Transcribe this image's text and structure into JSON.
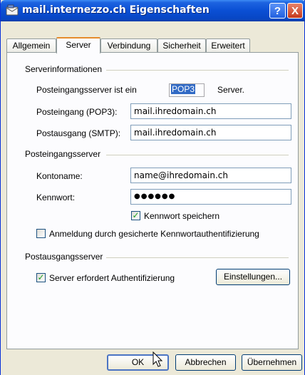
{
  "window": {
    "title": "mail.internezzo.ch Eigenschaften",
    "help_label": "?",
    "close_label": "X"
  },
  "tabs": [
    {
      "label": "Allgemein",
      "active": false
    },
    {
      "label": "Server",
      "active": true
    },
    {
      "label": "Verbindung",
      "active": false
    },
    {
      "label": "Sicherheit",
      "active": false
    },
    {
      "label": "Erweitert",
      "active": false
    }
  ],
  "serverinfo": {
    "group_label": "Serverinformationen",
    "type_label": "Posteingangsserver ist ein",
    "type_value": "POP3",
    "type_suffix": "Server.",
    "incoming_label": "Posteingang (POP3):",
    "incoming_value": "mail.ihredomain.ch",
    "outgoing_label": "Postausgang (SMTP):",
    "outgoing_value": "mail.ihredomain.ch"
  },
  "incoming": {
    "group_label": "Posteingangsserver",
    "account_label": "Kontoname:",
    "account_value": "name@ihredomain.ch",
    "password_label": "Kennwort:",
    "password_value": "●●●●●●",
    "remember_label": "Kennwort speichern",
    "remember_checked": true,
    "spa_label": "Anmeldung durch gesicherte Kennwortauthentifizierung",
    "spa_checked": false
  },
  "outgoing": {
    "group_label": "Postausgangsserver",
    "auth_label": "Server erfordert Authentifizierung",
    "auth_checked": true,
    "settings_label": "Einstellungen..."
  },
  "buttons": {
    "ok": "OK",
    "cancel": "Abbrechen",
    "apply": "Übernehmen"
  }
}
